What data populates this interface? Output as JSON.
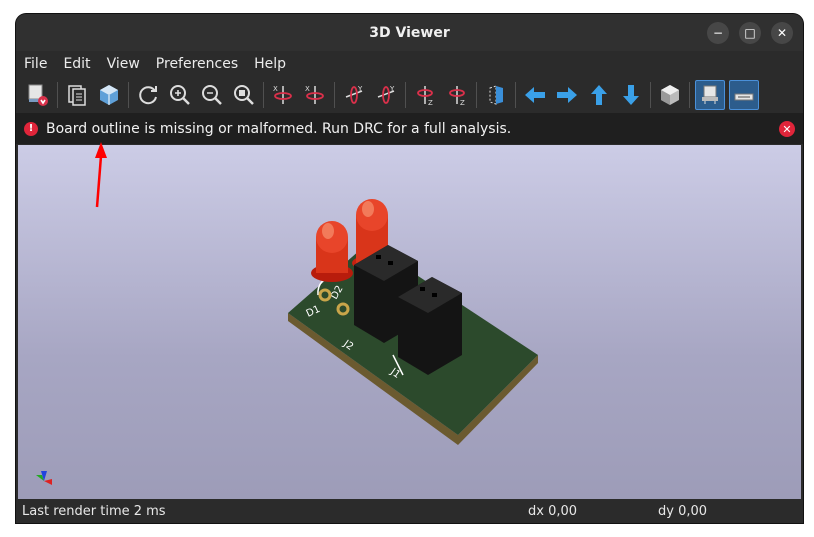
{
  "window": {
    "title": "3D Viewer"
  },
  "window_controls": {
    "minimize": "−",
    "maximize": "□",
    "close": "✕"
  },
  "menu": [
    "File",
    "Edit",
    "View",
    "Preferences",
    "Help"
  ],
  "toolbar_icons": [
    "render-mode-icon",
    "copy-icon",
    "board-view-icon",
    "reload-icon",
    "zoom-in-icon",
    "zoom-out-icon",
    "zoom-fit-icon",
    "rotate-x-cw-icon",
    "rotate-x-ccw-icon",
    "rotate-y-cw-icon",
    "rotate-y-ccw-icon",
    "rotate-z-cw-icon",
    "rotate-z-ccw-icon",
    "flip-board-icon",
    "move-left-icon",
    "move-right-icon",
    "move-up-icon",
    "move-down-icon",
    "ortho-toggle-icon",
    "raytracing-icon",
    "opengl-icon"
  ],
  "infobar": {
    "icon": "!",
    "message": "Board outline is missing or malformed. Run DRC for a full analysis.",
    "close": "✕"
  },
  "board": {
    "labels": [
      "D1",
      "D2",
      "J2",
      "J1"
    ]
  },
  "status": {
    "render_time": "Last render time 2 ms",
    "dx": "dx 0,00",
    "dy": "dy 0,00"
  },
  "colors": {
    "accent": "#4a90d9",
    "error": "#e0253a",
    "arrow": "#ff0000",
    "board": "#2c4a2c"
  }
}
